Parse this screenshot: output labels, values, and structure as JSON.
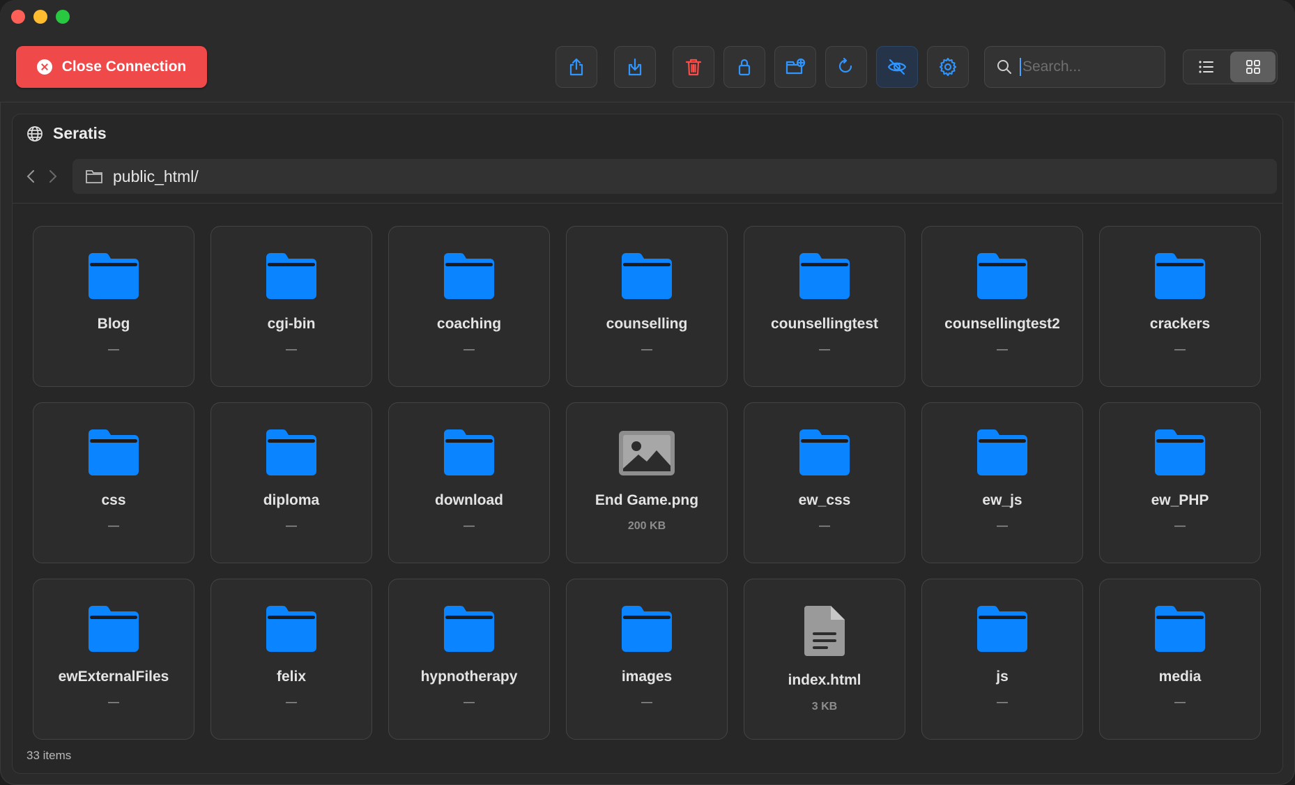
{
  "toolbar": {
    "close_label": "Close Connection",
    "search_placeholder": "Search...",
    "search_value": "",
    "buttons": [
      "upload-icon",
      "download-icon",
      "trash-icon",
      "lock-icon",
      "new-folder-icon",
      "refresh-icon",
      "hidden-files-icon",
      "gear-icon"
    ],
    "view_mode": "grid"
  },
  "colors": {
    "accent": "#0a84ff",
    "danger": "#f0494a",
    "folder": "#0a84ff"
  },
  "server": {
    "name": "Seratis"
  },
  "path": {
    "current": "public_html/"
  },
  "files": [
    {
      "name": "Blog",
      "size": "—",
      "kind": "folder"
    },
    {
      "name": "cgi-bin",
      "size": "—",
      "kind": "folder"
    },
    {
      "name": "coaching",
      "size": "—",
      "kind": "folder"
    },
    {
      "name": "counselling",
      "size": "—",
      "kind": "folder"
    },
    {
      "name": "counsellingtest",
      "size": "—",
      "kind": "folder"
    },
    {
      "name": "counsellingtest2",
      "size": "—",
      "kind": "folder"
    },
    {
      "name": "crackers",
      "size": "—",
      "kind": "folder"
    },
    {
      "name": "css",
      "size": "—",
      "kind": "folder"
    },
    {
      "name": "diploma",
      "size": "—",
      "kind": "folder"
    },
    {
      "name": "download",
      "size": "—",
      "kind": "folder"
    },
    {
      "name": "End Game.png",
      "size": "200 KB",
      "kind": "image"
    },
    {
      "name": "ew_css",
      "size": "—",
      "kind": "folder"
    },
    {
      "name": "ew_js",
      "size": "—",
      "kind": "folder"
    },
    {
      "name": "ew_PHP",
      "size": "—",
      "kind": "folder"
    },
    {
      "name": "ewExternalFiles",
      "size": "—",
      "kind": "folder"
    },
    {
      "name": "felix",
      "size": "—",
      "kind": "folder"
    },
    {
      "name": "hypnotherapy",
      "size": "—",
      "kind": "folder"
    },
    {
      "name": "images",
      "size": "—",
      "kind": "folder"
    },
    {
      "name": "index.html",
      "size": "3 KB",
      "kind": "document"
    },
    {
      "name": "js",
      "size": "—",
      "kind": "folder"
    },
    {
      "name": "media",
      "size": "—",
      "kind": "folder"
    }
  ],
  "footer": {
    "count": "33 items"
  }
}
